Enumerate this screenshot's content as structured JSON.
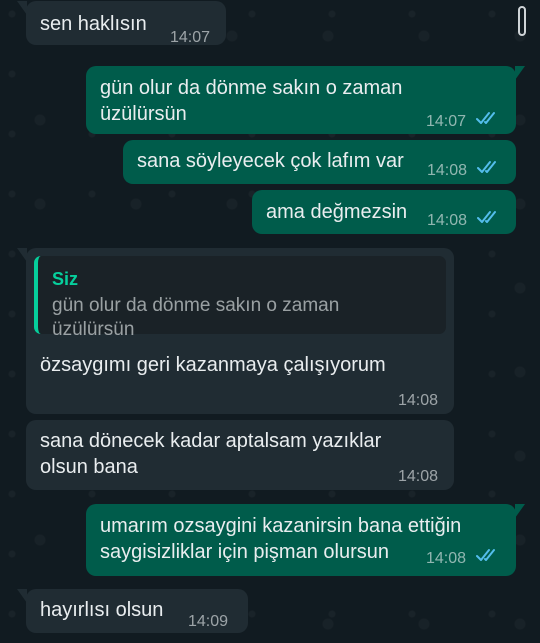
{
  "chat": {
    "messages": [
      {
        "dir": "in",
        "text": "sen haklısın",
        "time": "14:07"
      },
      {
        "dir": "out",
        "text_lines": [
          "gün olur da dönme sakın o zaman",
          "üzülürsün"
        ],
        "time": "14:07",
        "read": true
      },
      {
        "dir": "out",
        "text": "sana söyleyecek çok lafım var",
        "time": "14:08",
        "read": true
      },
      {
        "dir": "out",
        "text": "ama değmezsin",
        "time": "14:08",
        "read": true
      },
      {
        "dir": "in",
        "quote": {
          "author": "Siz",
          "text": "gün olur da dönme sakın o zaman üzülürsün"
        },
        "text": "özsaygımı geri kazanmaya çalışıyorum",
        "time": "14:08"
      },
      {
        "dir": "in",
        "text_lines": [
          "sana dönecek kadar aptalsam yazıklar",
          "olsun bana"
        ],
        "time": "14:08"
      },
      {
        "dir": "out",
        "text_lines": [
          "umarım ozsaygini kazanirsin bana ettiğin",
          "saygisizliklar için pişman olursun"
        ],
        "time": "14:08",
        "read": true
      },
      {
        "dir": "in",
        "text": "hayırlısı olsun",
        "time": "14:09"
      }
    ]
  },
  "colors": {
    "incoming_bubble": "#202c33",
    "outgoing_bubble": "#005c4b",
    "read_ticks": "#53bdeb",
    "quote_accent": "#06cf9c"
  },
  "icons": {
    "read_receipt": "double-check-icon"
  }
}
